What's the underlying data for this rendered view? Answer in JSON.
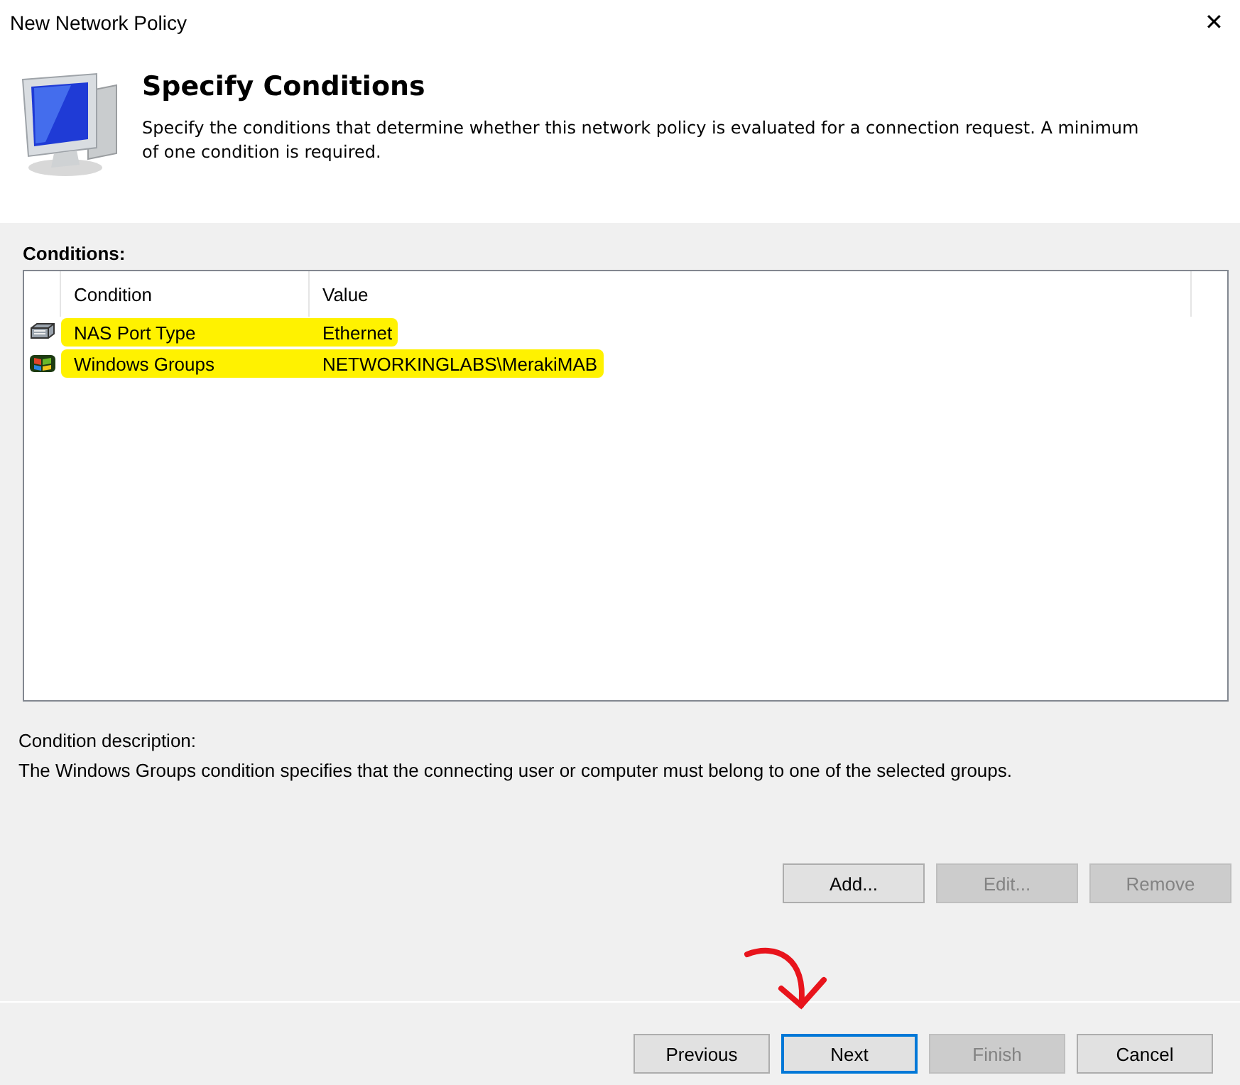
{
  "window": {
    "title": "New Network Policy",
    "close": "✕"
  },
  "header": {
    "title": "Specify Conditions",
    "description": [
      "Specify the conditions that determine whether this network policy is evaluated for a connection request. A minimum",
      "of one condition is required."
    ]
  },
  "conditions": {
    "label": "Conditions:",
    "columns": [
      "Condition",
      "Value"
    ],
    "rows": [
      {
        "kind": "port",
        "condition": "NAS Port Type",
        "value": "Ethernet",
        "highlighted": true
      },
      {
        "kind": "groups",
        "condition": "Windows Groups",
        "value": "NETWORKINGLABS\\MerakiMAB",
        "highlighted": true
      }
    ]
  },
  "condition_description": {
    "label": "Condition description:",
    "text": "The Windows Groups condition specifies that the connecting user or computer must belong to one of the selected groups."
  },
  "list_buttons": [
    {
      "label": "Add...",
      "disabled": false
    },
    {
      "label": "Edit...",
      "disabled": true
    },
    {
      "label": "Remove",
      "disabled": true
    }
  ],
  "footer_buttons": [
    {
      "label": "Previous",
      "disabled": false,
      "default": false
    },
    {
      "label": "Next",
      "disabled": false,
      "default": true
    },
    {
      "label": "Finish",
      "disabled": true,
      "default": false
    },
    {
      "label": "Cancel",
      "disabled": false,
      "default": false
    }
  ]
}
